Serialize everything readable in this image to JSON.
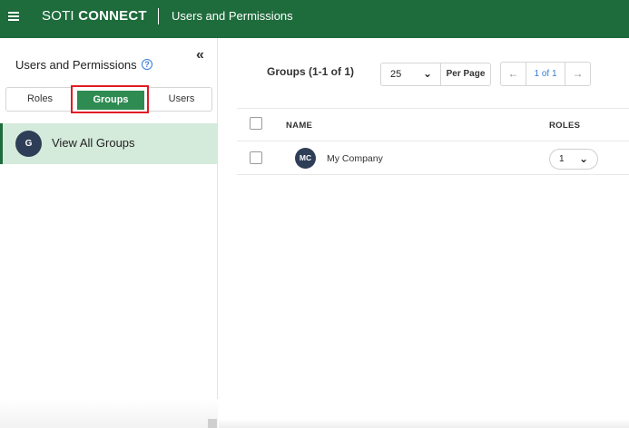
{
  "header": {
    "brand_light": "SOTI",
    "brand_bold": "CONNECT",
    "page_title": "Users and Permissions",
    "menu_icon": "hamburger-menu-icon",
    "bg_color": "#1e6b3c"
  },
  "sidebar": {
    "title": "Users and Permissions",
    "help_icon": "help-circle-icon",
    "collapse_icon": "double-chevron-left-icon",
    "tabs": [
      {
        "label": "Roles",
        "selected": false
      },
      {
        "label": "Groups",
        "selected": true
      },
      {
        "label": "Users",
        "selected": false
      }
    ],
    "items": [
      {
        "avatar": "G",
        "label": "View All Groups",
        "selected": true
      }
    ]
  },
  "main": {
    "count_title": "Groups (1-1 of 1)",
    "per_page": {
      "value": "25",
      "label": "Per Page"
    },
    "pager": {
      "label": "1 of 1",
      "prev_icon": "arrow-left-icon",
      "next_icon": "arrow-right-icon"
    },
    "table": {
      "columns": [
        "NAME",
        "ROLES"
      ],
      "rows": [
        {
          "avatar": "MC",
          "name": "My Company",
          "roles": "1"
        }
      ]
    }
  }
}
